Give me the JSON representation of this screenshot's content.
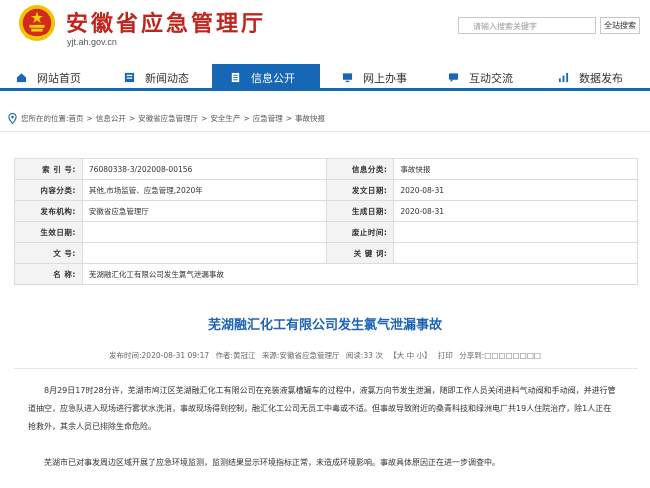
{
  "header": {
    "site_title": "安徽省应急管理厅",
    "site_domain": "yjt.ah.gov.cn",
    "search_placeholder": "请输入搜索关键字",
    "search_button": "全站搜索",
    "emblem_icon": "national-emblem-icon",
    "brand_color": "#c0251c"
  },
  "nav": {
    "accent_color": "#1668b7",
    "items": [
      {
        "label": "网站首页",
        "icon": "home-icon",
        "active": false
      },
      {
        "label": "新闻动态",
        "icon": "news-icon",
        "active": false
      },
      {
        "label": "信息公开",
        "icon": "document-icon",
        "active": true
      },
      {
        "label": "网上办事",
        "icon": "monitor-icon",
        "active": false
      },
      {
        "label": "互动交流",
        "icon": "chat-icon",
        "active": false
      },
      {
        "label": "数据发布",
        "icon": "bar-chart-icon",
        "active": false
      }
    ]
  },
  "breadcrumb": {
    "prefix": "您所在的位置:",
    "items": [
      "首页",
      "信息公开",
      "安徽省应急管理厅",
      "安全生产",
      "应急管理",
      "事故快报"
    ]
  },
  "info_table": {
    "rows": [
      {
        "k1": "索 引 号:",
        "v1": "76080338-3/202008-00156",
        "k2": "信息分类:",
        "v2": "事故快报"
      },
      {
        "k1": "内容分类:",
        "v1": "其他,市场监管、应急管理,2020年",
        "k2": "发文日期:",
        "v2": "2020-08-31"
      },
      {
        "k1": "发布机构:",
        "v1": "安徽省应急管理厅",
        "k2": "生成日期:",
        "v2": "2020-08-31"
      },
      {
        "k1": "生效日期:",
        "v1": "",
        "k2": "废止时间:",
        "v2": ""
      },
      {
        "k1": "文    号:",
        "v1": "",
        "k2": "关 键 词:",
        "v2": ""
      }
    ],
    "name_label": "名    称:",
    "name_value": "芜湖融汇化工有限公司发生氯气泄漏事故"
  },
  "article": {
    "title": "芜湖融汇化工有限公司发生氯气泄漏事故",
    "meta": {
      "date": "发布时间:2020-08-31 09:17",
      "author": "作者:黄冠江",
      "source": "来源:安徽省应急管理厅",
      "views": "阅读:33 次",
      "font": "【大 中 小】",
      "print": "打印",
      "share": "分享到:□□□□□□□□"
    },
    "p1": "8月29日17时28分许，芜湖市鸠江区芜湖融汇化工有限公司在充装液氯槽罐车的过程中，液氯万向节发生泄漏，随即工作人员关闭进料气动阀和手动阀，并进行管道抽空，应急队进入现场进行雾状水洗消，事故现场得到控制，融汇化工公司无员工中毒或不适。但事故导致附近的桑青科技和绿洲电厂共19人住院治疗，除1人正在抢救外，其余人员已排除生命危险。",
    "p2": "芜湖市已对事发周边区域开展了应急环境监测，监测结果显示环境指标正常，未造成环境影响。事故具体原因正在进一步调查中。",
    "title_color": "#1f63b3"
  }
}
